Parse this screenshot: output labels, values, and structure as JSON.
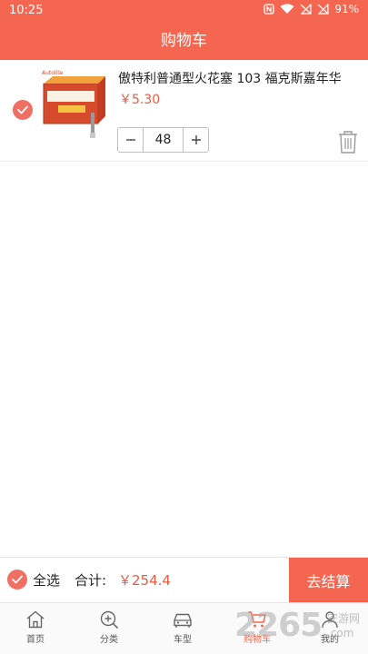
{
  "status_bar": {
    "time": "10:25",
    "battery": "91%"
  },
  "header": {
    "title": "购物车"
  },
  "cart": {
    "items": [
      {
        "title": "傲特利普通型火花塞 103  福克斯嘉年华",
        "price": "￥5.30",
        "quantity": "48",
        "selected": true,
        "image_brand": "Autolite"
      }
    ]
  },
  "summary": {
    "select_all_label": "全选",
    "total_label": "合计:",
    "total_value": "￥254.4",
    "checkout_label": "去结算"
  },
  "tabs": [
    {
      "label": "首页",
      "icon": "home-icon",
      "active": false
    },
    {
      "label": "分类",
      "icon": "category-icon",
      "active": false
    },
    {
      "label": "车型",
      "icon": "car-icon",
      "active": false
    },
    {
      "label": "购物车",
      "icon": "cart-icon",
      "active": true
    },
    {
      "label": "我的",
      "icon": "user-icon",
      "active": false
    }
  ],
  "watermark": {
    "number": "2265",
    "site_cn": "安游网",
    "site_url": ".com"
  },
  "colors": {
    "accent": "#f4664f",
    "price": "#e8593f",
    "check": "#ef6f62"
  }
}
